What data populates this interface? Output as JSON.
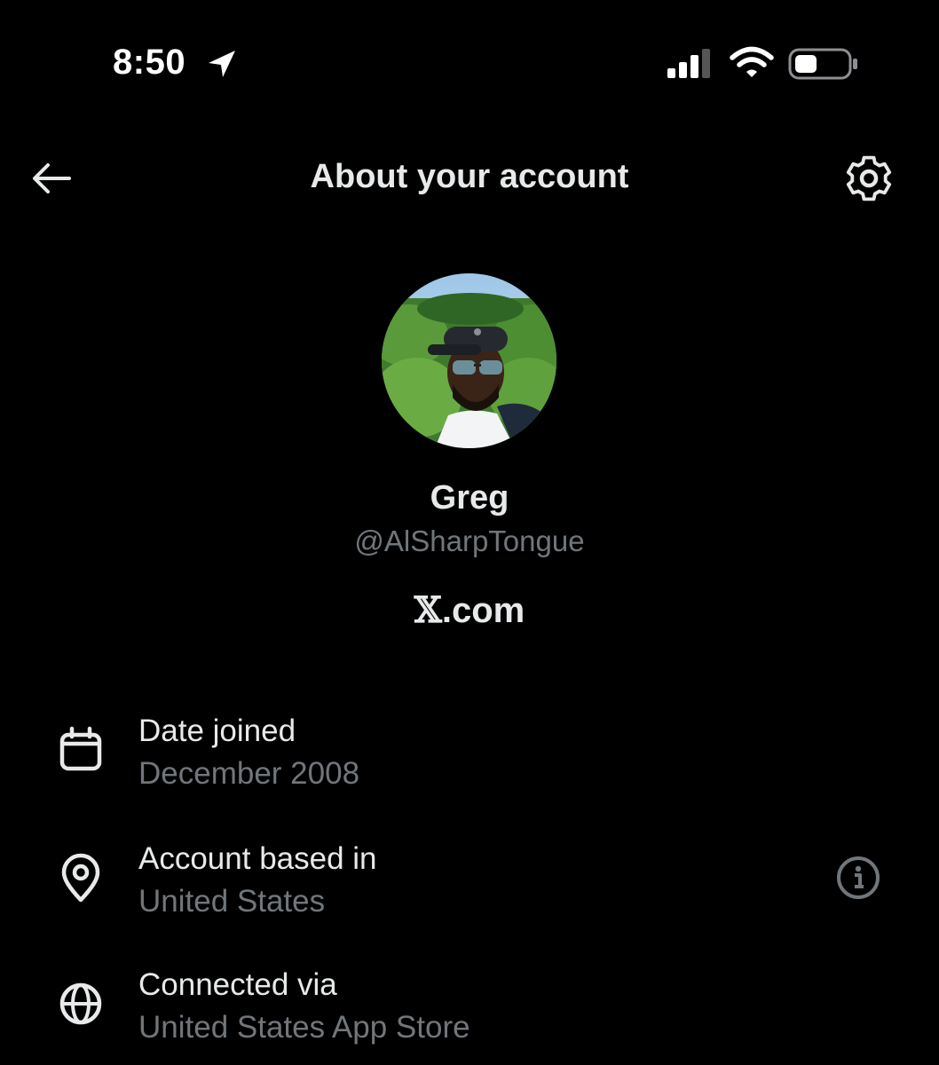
{
  "status_bar": {
    "time": "8:50",
    "icons": [
      "location-arrow-icon",
      "cellular-signal-icon",
      "wifi-icon",
      "battery-icon"
    ]
  },
  "header": {
    "title": "About your account",
    "back_icon": "arrow-left-icon",
    "settings_icon": "gear-icon"
  },
  "profile": {
    "name": "Greg",
    "handle": "@AlSharpTongue",
    "brand_logo": "𝕏",
    "brand_suffix": ".com"
  },
  "details": [
    {
      "icon": "calendar-icon",
      "label": "Date joined",
      "value": "December 2008"
    },
    {
      "icon": "location-pin-icon",
      "label": "Account based in",
      "value": "United States",
      "info_icon": "info-icon"
    },
    {
      "icon": "globe-icon",
      "label": "Connected via",
      "value": "United States App Store"
    }
  ],
  "colors": {
    "background": "#000000",
    "primary_text": "#e7e9ea",
    "secondary_text": "#71767b"
  }
}
